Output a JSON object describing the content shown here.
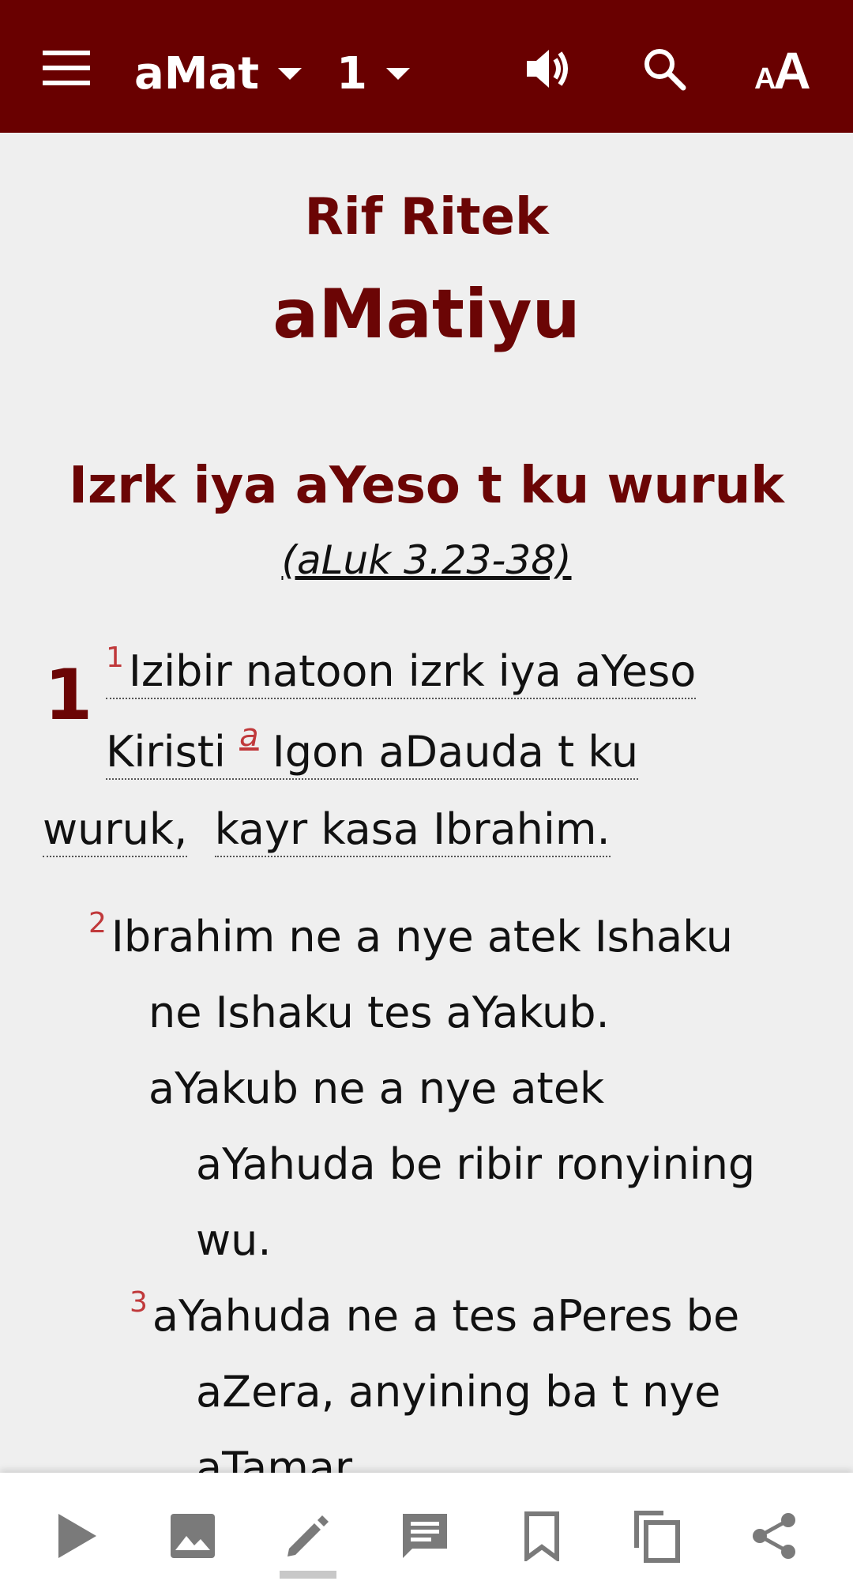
{
  "header": {
    "book": "aMat",
    "chapter": "1"
  },
  "content": {
    "book_group": "Rif Ritek",
    "book_title": "aMatiyu",
    "section_heading": "Izrk iya aYeso t ku wuruk",
    "cross_reference": "(aLuk 3.23-38)",
    "chapter_number": "1",
    "verse1": {
      "number": "1",
      "line1": "Izibir natoon izrk iya aYeso",
      "line2a": "Kiristi",
      "footnote": "a",
      "line2b": "Igon aDauda t ku",
      "line3a": "wuruk,",
      "line3b": "kayr kasa Ibrahim."
    },
    "verse2": {
      "number": "2",
      "line1": "Ibrahim ne a nye atek Ishaku",
      "line2": "ne Ishaku tes aYakub.",
      "line3": "aYakub ne a nye atek",
      "line4": "aYahuda be ribir ronyining",
      "line5": "wu."
    },
    "verse3": {
      "number": "3",
      "line1": "aYahuda ne a tes aPeres be",
      "line2": "aZera, anyining ba t nye",
      "line3": "aTamar."
    }
  },
  "bottom_bar": {
    "items": [
      "play-icon",
      "image-icon",
      "pencil-icon",
      "comment-icon",
      "bookmark-icon",
      "copy-icon",
      "share-icon"
    ]
  },
  "colors": {
    "header_bg": "#690000",
    "heading": "#6b0505",
    "verse_number": "#c0393b",
    "background": "#efefef"
  }
}
